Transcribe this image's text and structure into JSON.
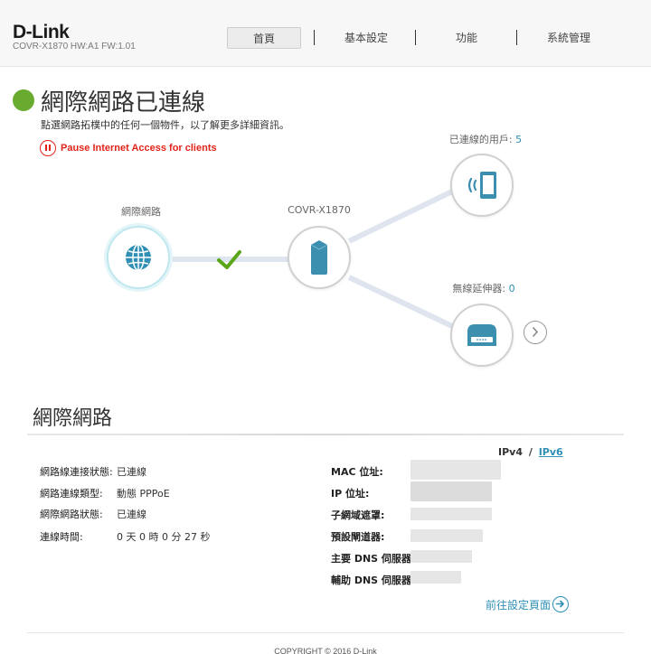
{
  "header": {
    "logo": "D-Link",
    "model": "COVR-X1870 HW:A1 FW:1.01",
    "nav": [
      {
        "label": "首頁",
        "active": true
      },
      {
        "label": "基本設定",
        "active": false
      },
      {
        "label": "功能",
        "active": false
      },
      {
        "label": "系統管理",
        "active": false
      }
    ]
  },
  "status": {
    "title": "網際網路已連線",
    "subtitle": "點選網路拓樸中的任何一個物件，以了解更多詳細資訊。",
    "pause_label": "Pause Internet Access for clients",
    "status_color": "#68ab2e"
  },
  "topology": {
    "internet_label": "網際網路",
    "router_label": "COVR-X1870",
    "clients_label": "已連線的用戶:",
    "clients_count": "5",
    "extenders_label": "無線延伸器:",
    "extenders_count": "0",
    "icons": [
      "globe-icon",
      "router-icon",
      "tablet-icon",
      "extender-icon",
      "checkmark-icon",
      "chevron-right-icon"
    ]
  },
  "internet_section": {
    "title": "網際網路",
    "ipv4": "IPv4",
    "separator": "/",
    "ipv6": "IPv6",
    "left_rows": [
      {
        "label": "網路線連接狀態:",
        "value": "已連線"
      },
      {
        "label": "網路連線類型:",
        "value": "動態 PPPoE"
      },
      {
        "label": "網際網路狀態:",
        "value": "已連線"
      },
      {
        "label": "連線時間:",
        "value": "0 天 0 時 0 分 27 秒"
      }
    ],
    "right_rows": [
      {
        "label": "MAC 位址:"
      },
      {
        "label": "IP 位址:"
      },
      {
        "label": "子網域遮罩:"
      },
      {
        "label": "預設閘道器:"
      },
      {
        "label": "主要 DNS 伺服器:"
      },
      {
        "label": "輔助 DNS 伺服器:"
      }
    ],
    "goto_settings": "前往設定頁面"
  },
  "footer": {
    "copyright": "COPYRIGHT © 2016 D-Link"
  },
  "colors": {
    "accent": "#2f8fb5",
    "alert": "#e2231a",
    "check": "#5aa618",
    "device": "#3d8fb0"
  }
}
